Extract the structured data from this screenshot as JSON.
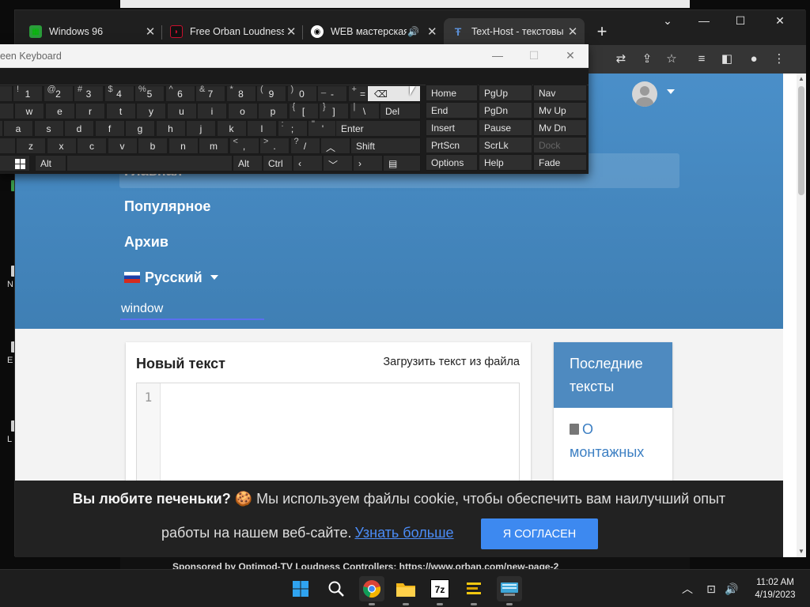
{
  "desktop": {
    "icons": [
      {
        "name": "desktop-icon-1",
        "label": ""
      },
      {
        "name": "desktop-icon-2",
        "label": "N"
      },
      {
        "name": "desktop-icon-3",
        "label": "E"
      },
      {
        "name": "desktop-icon-4",
        "label": "L"
      }
    ],
    "bg_window_text": "Sponsored by Optimod-TV Loudness Controllers: https://www.orban.com/new-page-2"
  },
  "browser": {
    "tabs": [
      {
        "title": "Windows 96",
        "icon": "windows96-icon",
        "color": "#2a9d3a"
      },
      {
        "title": "Free Orban Loudness",
        "icon": "orban-icon",
        "color": "#c8102e"
      },
      {
        "title": "WEB мастерская",
        "icon": "web-workshop-icon",
        "color": "#ffffff"
      },
      {
        "title": "Text-Host - текстовы",
        "icon": "texthost-icon",
        "color": "#5b8fd6"
      }
    ],
    "new_tab": "+",
    "window_controls": {
      "minimize": "—",
      "maximize": "☐",
      "close": "✕",
      "dropdown": "⌄"
    }
  },
  "site": {
    "nav": {
      "home": "Главная",
      "popular": "Популярное",
      "archive": "Архив",
      "language": "Русский"
    },
    "search_value": "window",
    "new_text_title": "Новый текст",
    "upload_link": "Загрузить текст из файла",
    "editor_line": "1",
    "recent_title_1": "Последние",
    "recent_title_2": "тексты",
    "recent_link_1": "О",
    "recent_link_2": "монтажных"
  },
  "cookie": {
    "question": "Вы любите печеньки?",
    "emoji": "🍪",
    "text1": "Мы используем файлы cookie, чтобы обеспечить вам наилучший опыт",
    "text2": "работы на нашем веб-сайте.",
    "link": "Узнать больше",
    "button": "Я СОГЛАСЕН"
  },
  "osk": {
    "title": "een Keyboard",
    "rows": [
      [
        {
          "m": "1",
          "s": "!"
        },
        {
          "m": "2",
          "s": "@"
        },
        {
          "m": "3",
          "s": "#"
        },
        {
          "m": "4",
          "s": "$"
        },
        {
          "m": "5",
          "s": "%"
        },
        {
          "m": "6",
          "s": "^"
        },
        {
          "m": "7",
          "s": "&"
        },
        {
          "m": "8",
          "s": "*"
        },
        {
          "m": "9",
          "s": "("
        },
        {
          "m": "0",
          "s": ")"
        },
        {
          "m": "-",
          "s": "_"
        },
        {
          "m": "=",
          "s": "+"
        }
      ],
      [
        {
          "m": "w"
        },
        {
          "m": "e"
        },
        {
          "m": "r"
        },
        {
          "m": "t"
        },
        {
          "m": "y"
        },
        {
          "m": "u"
        },
        {
          "m": "i"
        },
        {
          "m": "o"
        },
        {
          "m": "p"
        },
        {
          "m": "[",
          "s": "{"
        },
        {
          "m": "]",
          "s": "}"
        },
        {
          "m": "\\",
          "s": "|"
        }
      ],
      [
        {
          "m": "a"
        },
        {
          "m": "s"
        },
        {
          "m": "d"
        },
        {
          "m": "f"
        },
        {
          "m": "g"
        },
        {
          "m": "h"
        },
        {
          "m": "j"
        },
        {
          "m": "k"
        },
        {
          "m": "l"
        },
        {
          "m": ";",
          "s": ":"
        },
        {
          "m": "'",
          "s": "\""
        }
      ],
      [
        {
          "m": "z"
        },
        {
          "m": "x"
        },
        {
          "m": "c"
        },
        {
          "m": "v"
        },
        {
          "m": "b"
        },
        {
          "m": "n"
        },
        {
          "m": "m"
        },
        {
          "m": ",",
          "s": "<"
        },
        {
          "m": ".",
          "s": ">"
        },
        {
          "m": "/",
          "s": "?"
        }
      ]
    ],
    "enter": "Enter",
    "del": "Del",
    "shift": "Shift",
    "alt_left": "Alt",
    "alt_right": "Alt",
    "ctrl": "Ctrl",
    "nav_keys": [
      [
        "Home",
        "PgUp",
        "Nav"
      ],
      [
        "End",
        "PgDn",
        "Mv Up"
      ],
      [
        "Insert",
        "Pause",
        "Mv Dn"
      ],
      [
        "PrtScn",
        "ScrLk",
        "Dock"
      ],
      [
        "Options",
        "Help",
        "Fade"
      ]
    ]
  },
  "taskbar": {
    "apps": [
      {
        "name": "start-button",
        "icon": "windows-logo-icon"
      },
      {
        "name": "search-button",
        "icon": "search-icon"
      },
      {
        "name": "chrome-app",
        "icon": "chrome-icon"
      },
      {
        "name": "file-explorer-app",
        "icon": "folder-icon"
      },
      {
        "name": "7zip-app",
        "icon": "7zip-icon",
        "label": "7z"
      },
      {
        "name": "notes-app",
        "icon": "notes-icon"
      },
      {
        "name": "osk-app",
        "icon": "keyboard-icon"
      }
    ],
    "time": "11:02 AM",
    "date": "4/19/2023"
  }
}
